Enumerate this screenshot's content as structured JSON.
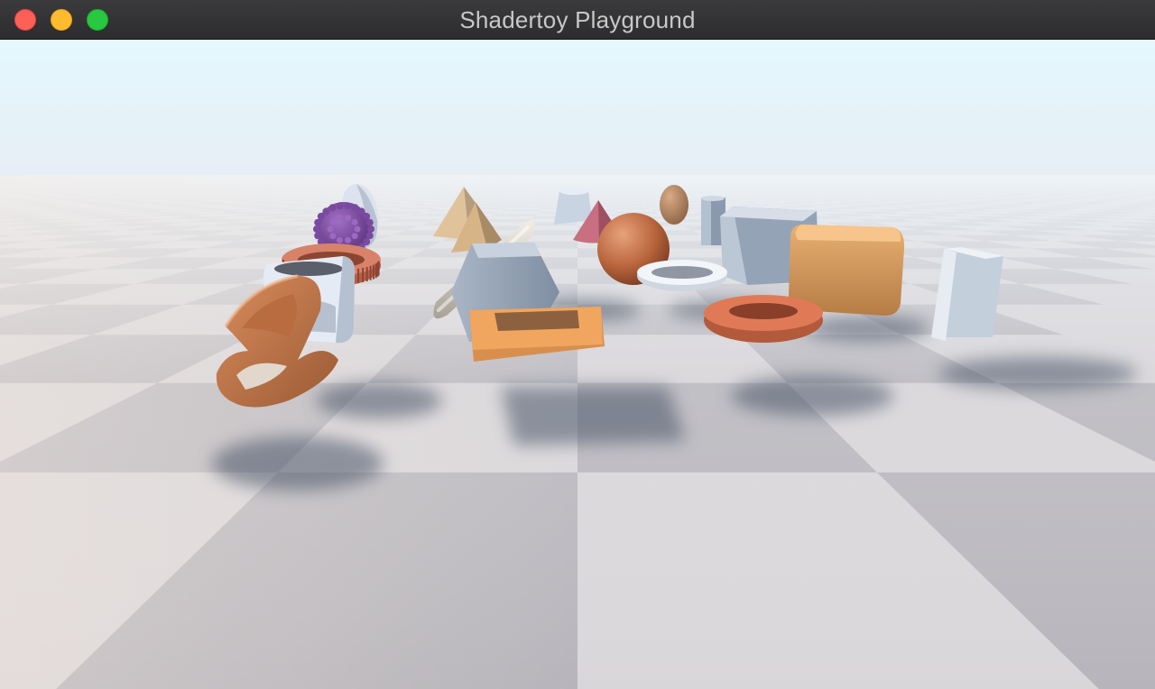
{
  "window": {
    "title": "Shadertoy Playground",
    "buttons": {
      "close_color": "#fe5f57",
      "minimize_color": "#febc2e",
      "zoom_color": "#28c840"
    }
  },
  "scene": {
    "sky_top_color": "#e4f8fe",
    "sky_horizon_color": "#e8f0f6",
    "floor_colors": [
      "#d9d6d9",
      "#b7b5bb"
    ],
    "objects": [
      "bulb",
      "spiky-ball",
      "gear-ring",
      "rounded-box-frame",
      "twisted-ribbon",
      "pyramid",
      "triangular-prism",
      "capsule",
      "hexagonal-prism",
      "square-frame",
      "cone-frustum",
      "cone",
      "sphere",
      "small-sphere",
      "cylinder",
      "box",
      "torus",
      "rounded-cube",
      "flat-torus",
      "box-prism"
    ]
  }
}
